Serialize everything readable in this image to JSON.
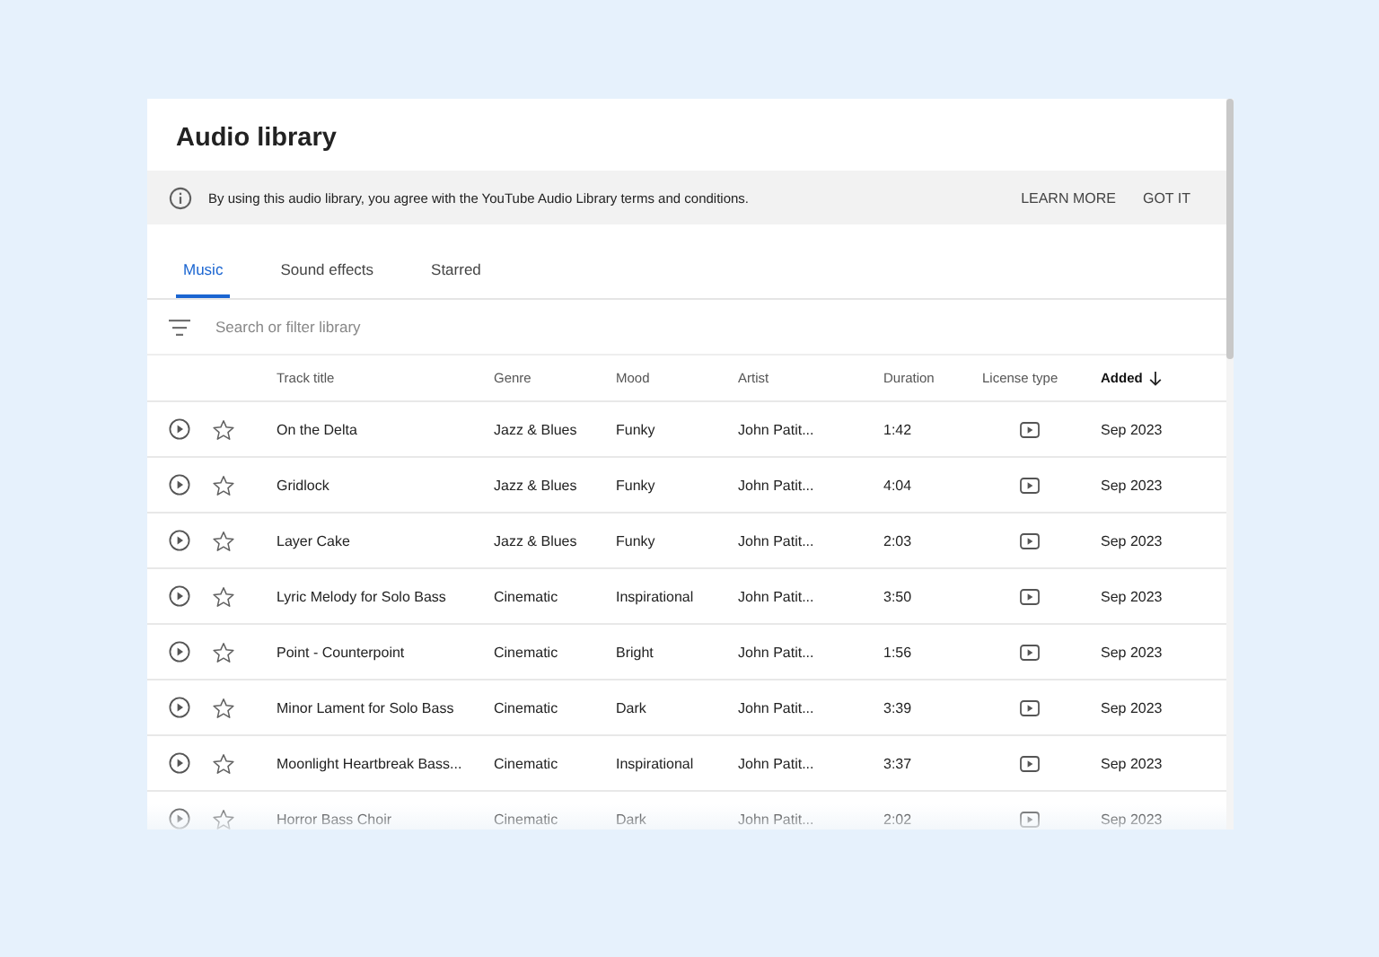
{
  "title": "Audio library",
  "notice": {
    "text": "By using this audio library, you agree with the YouTube Audio Library terms and conditions.",
    "actions": [
      "LEARN MORE",
      "GOT IT"
    ]
  },
  "tabs": [
    {
      "label": "Music",
      "selected": true
    },
    {
      "label": "Sound effects",
      "selected": false
    },
    {
      "label": "Starred",
      "selected": false
    }
  ],
  "search": {
    "placeholder": "Search or filter library"
  },
  "columns": [
    {
      "label": "Track title",
      "sorted": false
    },
    {
      "label": "Genre",
      "sorted": false
    },
    {
      "label": "Mood",
      "sorted": false
    },
    {
      "label": "Artist",
      "sorted": false
    },
    {
      "label": "Duration",
      "sorted": false
    },
    {
      "label": "License type",
      "sorted": false
    },
    {
      "label": "Added",
      "sorted": true
    }
  ],
  "rows": [
    {
      "title": "On the Delta",
      "genre": "Jazz & Blues",
      "mood": "Funky",
      "artist": "John Patit...",
      "duration": "1:42",
      "added": "Sep 2023",
      "starred": false
    },
    {
      "title": "Gridlock",
      "genre": "Jazz & Blues",
      "mood": "Funky",
      "artist": "John Patit...",
      "duration": "4:04",
      "added": "Sep 2023",
      "starred": false
    },
    {
      "title": "Layer Cake",
      "genre": "Jazz & Blues",
      "mood": "Funky",
      "artist": "John Patit...",
      "duration": "2:03",
      "added": "Sep 2023",
      "starred": false
    },
    {
      "title": "Lyric Melody for Solo Bass",
      "genre": "Cinematic",
      "mood": "Inspirational",
      "artist": "John Patit...",
      "duration": "3:50",
      "added": "Sep 2023",
      "starred": false
    },
    {
      "title": "Point - Counterpoint",
      "genre": "Cinematic",
      "mood": "Bright",
      "artist": "John Patit...",
      "duration": "1:56",
      "added": "Sep 2023",
      "starred": false
    },
    {
      "title": "Minor Lament for Solo Bass",
      "genre": "Cinematic",
      "mood": "Dark",
      "artist": "John Patit...",
      "duration": "3:39",
      "added": "Sep 2023",
      "starred": false
    },
    {
      "title": "Moonlight Heartbreak Bass...",
      "genre": "Cinematic",
      "mood": "Inspirational",
      "artist": "John Patit...",
      "duration": "3:37",
      "added": "Sep 2023",
      "starred": false
    },
    {
      "title": "Horror Bass Choir",
      "genre": "Cinematic",
      "mood": "Dark",
      "artist": "John Patit...",
      "duration": "2:02",
      "added": "Sep 2023",
      "starred": false
    }
  ]
}
